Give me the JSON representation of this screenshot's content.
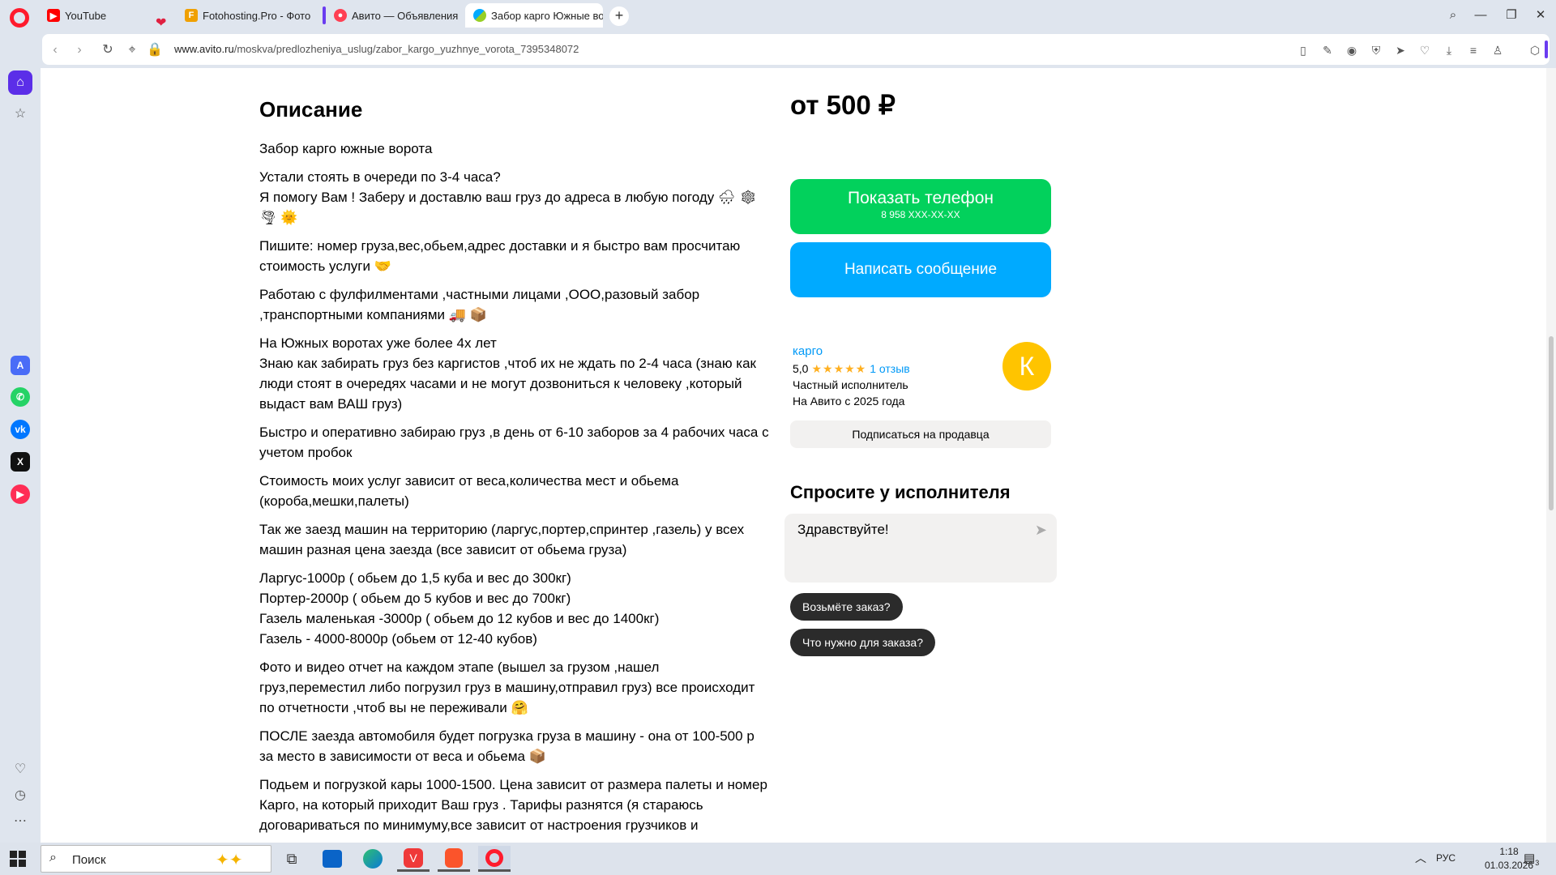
{
  "tabs": [
    {
      "title": "YouTube"
    },
    {
      "title": "Fotohosting.Pro - Фотохостинг"
    },
    {
      "title": "Авито — Объявления на сайте"
    },
    {
      "title": "Забор карго Южные ворота"
    }
  ],
  "address": {
    "domain": "www.avito.ru",
    "path": "/moskva/predlozheniya_uslug/zabor_kargo_yuzhnye_vorota_7395348072"
  },
  "description": {
    "heading": "Описание",
    "paragraphs": [
      [
        "Забор карго южные ворота"
      ],
      [
        "Устали стоять в очереди по 3-4 часа?",
        "Я помогу Вам ! Заберу и доставлю ваш груз до адреса в любую погоду 🌧 ❄",
        "🌪 🌞"
      ],
      [
        "Пишите: номер груза,вес,обьем,адрес доставки и я быстро вам просчитаю",
        "стоимость услуги 🤝"
      ],
      [
        "Работаю с фулфилментами ,частными лицами ,ООО,разовый забор",
        ",транспортными компаниями 🚚 📦"
      ],
      [
        "На Южных воротах уже более 4х лет",
        "Знаю как забирать груз без каргистов ,чтоб их не ждать по 2-4 часа (знаю как",
        "люди стоят в очередях часами и не могут дозвониться к человеку ,который",
        "выдаст вам ВАШ груз)"
      ],
      [
        "Быстро и оперативно забираю груз ,в день от 6-10 заборов за 4 рабочих часа с",
        "учетом пробок"
      ],
      [
        "Стоимость моих услуг зависит от веса,количества мест и обьема",
        "(короба,мешки,палеты)"
      ],
      [
        "Так же заезд машин на территорию (ларгус,портер,спринтер ,газель) у всех",
        "машин разная цена заезда (все зависит от обьема груза)"
      ],
      [
        "Ларгус-1000р ( обьем до 1,5 куба и вес до 300кг)",
        "Портер-2000р ( обьем до 5 кубов и вес до 700кг)",
        "Газель маленькая -3000р ( обьем до 12 кубов и вес до 1400кг)",
        "Газель - 4000-8000р (обьем от 12-40 кубов)"
      ],
      [
        "Фото и видео отчет на каждом этапе (вышел за грузом ,нашел",
        "груз,переместил либо погрузил груз в машину,отправил груз) все происходит",
        "по отчетности ,чтоб вы не переживали 🤗"
      ],
      [
        "ПОСЛЕ заезда автомобиля будет погрузка груза в машину - она от 100-500 р",
        "за место в зависимости от веса и обьема 📦"
      ],
      [
        "Подьем и погрузкой кары 1000-1500. Цена зависит от размера палеты и номер",
        "Карго, на который приходит Ваш груз . Тарифы разнятся (я стараюсь",
        "договариваться по минимуму,все зависит от настроения грузчиков и"
      ]
    ]
  },
  "offer": {
    "price": "от 500 ₽",
    "phone_label": "Показать телефон",
    "phone_number": "8 958 XXX-XX-XX",
    "message_label": "Написать сообщение"
  },
  "seller": {
    "name": "карго",
    "rating": "5,0",
    "stars": "★★★★★",
    "reviews": "1 отзыв",
    "type": "Частный исполнитель",
    "since": "На Авито с 2025 года",
    "avatar_letter": "К",
    "subscribe_label": "Подписаться на продавца"
  },
  "ask": {
    "title": "Спросите у исполнителя",
    "input_value": "Здравствуйте!",
    "chips": [
      "Возьмёте заказ?",
      "Что нужно для заказа?"
    ]
  },
  "taskbar": {
    "search_placeholder": "Поиск",
    "lang": "РУС",
    "time": "1:18",
    "date": "01.03.2026",
    "notifications": "3"
  },
  "colors": {
    "avito_green": "#02d15c",
    "avito_blue": "#00aaff",
    "link_blue": "#0099f7",
    "opera_red": "#ff1b2d",
    "star_yellow": "#ffb021",
    "avatar_yellow": "#ffc400"
  }
}
